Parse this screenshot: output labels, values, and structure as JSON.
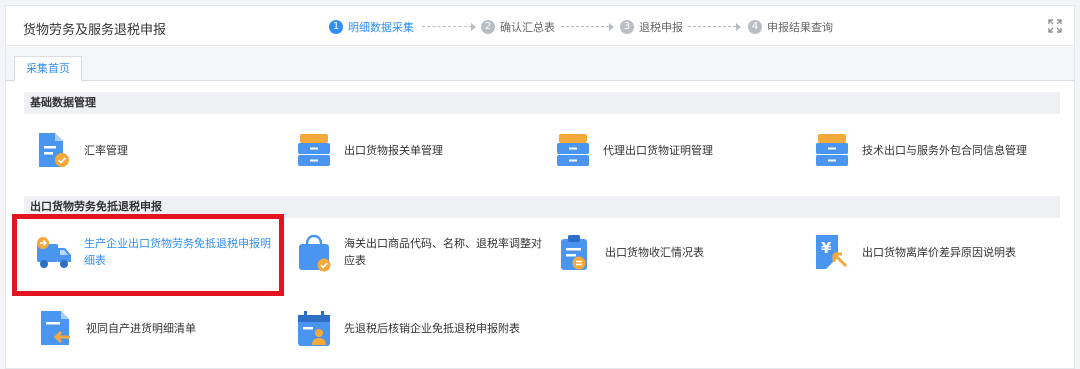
{
  "header": {
    "title": "货物劳务及服务退税申报",
    "steps": [
      {
        "num": "1",
        "label": "明细数据采集",
        "active": true
      },
      {
        "num": "2",
        "label": "确认汇总表",
        "active": false
      },
      {
        "num": "3",
        "label": "退税申报",
        "active": false
      },
      {
        "num": "4",
        "label": "申报结果查询",
        "active": false
      }
    ],
    "fullscreen_icon": "fullscreen-icon"
  },
  "tabs": [
    {
      "label": "采集首页"
    }
  ],
  "sections": [
    {
      "title": "基础数据管理",
      "items": [
        {
          "label": "汇率管理",
          "icon": "document-check-icon"
        },
        {
          "label": "出口货物报关单管理",
          "icon": "file-cabinet-icon"
        },
        {
          "label": "代理出口货物证明管理",
          "icon": "file-cabinet-icon"
        },
        {
          "label": "技术出口与服务外包合同信息管理",
          "icon": "file-cabinet-icon"
        }
      ]
    },
    {
      "title": "出口货物劳务免抵退税申报",
      "items": [
        {
          "label": "生产企业出口货物劳务免抵退税申报明细表",
          "icon": "truck-icon",
          "selected": true
        },
        {
          "label": "海关出口商品代码、名称、退税率调整对应表",
          "icon": "shopping-bag-icon"
        },
        {
          "label": "出口货物收汇情况表",
          "icon": "clipboard-icon"
        },
        {
          "label": "出口货物离岸价差异原因说明表",
          "icon": "yen-document-icon"
        },
        {
          "label": "视同自产进货明细清单",
          "icon": "document-arrow-icon"
        },
        {
          "label": "先退税后核销企业免抵退税申报附表",
          "icon": "calendar-person-icon"
        }
      ]
    }
  ],
  "colors": {
    "accent": "#2f8ff6",
    "icon_blue": "#4a95f0",
    "icon_orange": "#f5a93b",
    "highlight_red": "#e3131f"
  }
}
